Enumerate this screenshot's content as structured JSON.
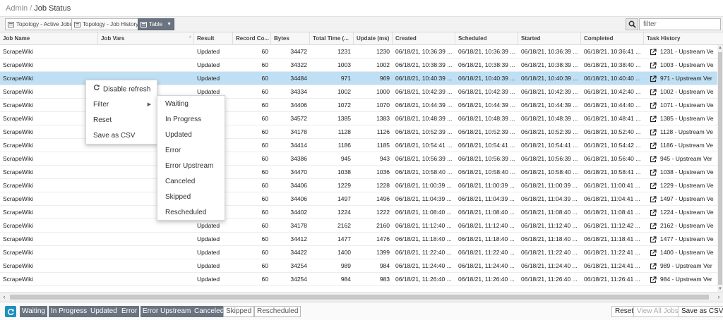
{
  "breadcrumb": {
    "admin": "Admin",
    "separator": "/",
    "current": "Job Status"
  },
  "toolbar": {
    "views": [
      {
        "label": "Topology - Active Jobs",
        "active": false
      },
      {
        "label": "Topology - Job History",
        "active": false
      },
      {
        "label": "Table",
        "active": true
      }
    ],
    "search_placeholder": "filter",
    "search_icon": "search-icon"
  },
  "table": {
    "columns": [
      "Job Name",
      "Job Vars",
      "Result",
      "Record Co...",
      "Bytes",
      "Total Time (...",
      "Update (ms)",
      "Created",
      "Scheduled",
      "Started",
      "Completed",
      "Task History"
    ],
    "sort_indicator": "^",
    "history_icon": "external-link-icon",
    "selected_row": 2,
    "rows": [
      {
        "name": "ScrapeWiki",
        "vars": "",
        "result": "Updated",
        "records": "60",
        "bytes": "34472",
        "total": "1231",
        "update": "1230",
        "created": "06/18/21, 10:36:39 ...",
        "scheduled": "06/18/21, 10:36:39 ...",
        "started": "06/18/21, 10:36:39 ...",
        "completed": "06/18/21, 10:36:41 ...",
        "history": "1231 - Upstream Ve"
      },
      {
        "name": "ScrapeWiki",
        "vars": "",
        "result": "Updated",
        "records": "60",
        "bytes": "34322",
        "total": "1003",
        "update": "1002",
        "created": "06/18/21, 10:38:39 ...",
        "scheduled": "06/18/21, 10:38:39 ...",
        "started": "06/18/21, 10:38:39 ...",
        "completed": "06/18/21, 10:38:40 ...",
        "history": "1003 - Upstream Ve"
      },
      {
        "name": "ScrapeWiki",
        "vars": "",
        "result": "Updated",
        "records": "60",
        "bytes": "34484",
        "total": "971",
        "update": "969",
        "created": "06/18/21, 10:40:39 ...",
        "scheduled": "06/18/21, 10:40:39 ...",
        "started": "06/18/21, 10:40:39 ...",
        "completed": "06/18/21, 10:40:40 ...",
        "history": "971 - Upstream Ver"
      },
      {
        "name": "ScrapeWiki",
        "vars": "",
        "result": "Updated",
        "records": "60",
        "bytes": "34334",
        "total": "1002",
        "update": "1000",
        "created": "06/18/21, 10:42:39 ...",
        "scheduled": "06/18/21, 10:42:39 ...",
        "started": "06/18/21, 10:42:39 ...",
        "completed": "06/18/21, 10:42:40 ...",
        "history": "1002 - Upstream Ve"
      },
      {
        "name": "ScrapeWiki",
        "vars": "",
        "result": "Updated",
        "records": "60",
        "bytes": "34406",
        "total": "1072",
        "update": "1070",
        "created": "06/18/21, 10:44:39 ...",
        "scheduled": "06/18/21, 10:44:39 ...",
        "started": "06/18/21, 10:44:39 ...",
        "completed": "06/18/21, 10:44:40 ...",
        "history": "1071 - Upstream Ve"
      },
      {
        "name": "ScrapeWiki",
        "vars": "",
        "result": "Updated",
        "records": "60",
        "bytes": "34572",
        "total": "1385",
        "update": "1383",
        "created": "06/18/21, 10:48:39 ...",
        "scheduled": "06/18/21, 10:48:39 ...",
        "started": "06/18/21, 10:48:39 ...",
        "completed": "06/18/21, 10:48:41 ...",
        "history": "1385 - Upstream Ve"
      },
      {
        "name": "ScrapeWiki",
        "vars": "",
        "result": "Updated",
        "records": "60",
        "bytes": "34178",
        "total": "1128",
        "update": "1126",
        "created": "06/18/21, 10:52:39 ...",
        "scheduled": "06/18/21, 10:52:39 ...",
        "started": "06/18/21, 10:52:39 ...",
        "completed": "06/18/21, 10:52:40 ...",
        "history": "1128 - Upstream Ve"
      },
      {
        "name": "ScrapeWiki",
        "vars": "",
        "result": "Updated",
        "records": "60",
        "bytes": "34414",
        "total": "1186",
        "update": "1185",
        "created": "06/18/21, 10:54:41 ...",
        "scheduled": "06/18/21, 10:54:41 ...",
        "started": "06/18/21, 10:54:41 ...",
        "completed": "06/18/21, 10:54:42 ...",
        "history": "1186 - Upstream Ve"
      },
      {
        "name": "ScrapeWiki",
        "vars": "",
        "result": "Updated",
        "records": "60",
        "bytes": "34386",
        "total": "945",
        "update": "943",
        "created": "06/18/21, 10:56:39 ...",
        "scheduled": "06/18/21, 10:56:39 ...",
        "started": "06/18/21, 10:56:39 ...",
        "completed": "06/18/21, 10:56:40 ...",
        "history": "945 - Upstream Ver"
      },
      {
        "name": "ScrapeWiki",
        "vars": "",
        "result": "Updated",
        "records": "60",
        "bytes": "34470",
        "total": "1038",
        "update": "1036",
        "created": "06/18/21, 10:58:40 ...",
        "scheduled": "06/18/21, 10:58:40 ...",
        "started": "06/18/21, 10:58:40 ...",
        "completed": "06/18/21, 10:58:41 ...",
        "history": "1038 - Upstream Ve"
      },
      {
        "name": "ScrapeWiki",
        "vars": "",
        "result": "Updated",
        "records": "60",
        "bytes": "34406",
        "total": "1229",
        "update": "1228",
        "created": "06/18/21, 11:00:39 ...",
        "scheduled": "06/18/21, 11:00:39 ...",
        "started": "06/18/21, 11:00:39 ...",
        "completed": "06/18/21, 11:00:41 ...",
        "history": "1229 - Upstream Ve"
      },
      {
        "name": "ScrapeWiki",
        "vars": "",
        "result": "Updated",
        "records": "60",
        "bytes": "34406",
        "total": "1497",
        "update": "1496",
        "created": "06/18/21, 11:04:39 ...",
        "scheduled": "06/18/21, 11:04:39 ...",
        "started": "06/18/21, 11:04:39 ...",
        "completed": "06/18/21, 11:04:41 ...",
        "history": "1497 - Upstream Ve"
      },
      {
        "name": "ScrapeWiki",
        "vars": "",
        "result": "Updated",
        "records": "60",
        "bytes": "34402",
        "total": "1224",
        "update": "1222",
        "created": "06/18/21, 11:08:40 ...",
        "scheduled": "06/18/21, 11:08:40 ...",
        "started": "06/18/21, 11:08:40 ...",
        "completed": "06/18/21, 11:08:41 ...",
        "history": "1224 - Upstream Ve"
      },
      {
        "name": "ScrapeWiki",
        "vars": "",
        "result": "Updated",
        "records": "60",
        "bytes": "34178",
        "total": "2162",
        "update": "2160",
        "created": "06/18/21, 11:12:40 ...",
        "scheduled": "06/18/21, 11:12:40 ...",
        "started": "06/18/21, 11:12:40 ...",
        "completed": "06/18/21, 11:12:42 ...",
        "history": "2162 - Upstream Ve"
      },
      {
        "name": "ScrapeWiki",
        "vars": "",
        "result": "Updated",
        "records": "60",
        "bytes": "34412",
        "total": "1477",
        "update": "1476",
        "created": "06/18/21, 11:18:40 ...",
        "scheduled": "06/18/21, 11:18:40 ...",
        "started": "06/18/21, 11:18:40 ...",
        "completed": "06/18/21, 11:18:41 ...",
        "history": "1477 - Upstream Ve"
      },
      {
        "name": "ScrapeWiki",
        "vars": "",
        "result": "Updated",
        "records": "60",
        "bytes": "34422",
        "total": "1400",
        "update": "1399",
        "created": "06/18/21, 11:22:40 ...",
        "scheduled": "06/18/21, 11:22:40 ...",
        "started": "06/18/21, 11:22:40 ...",
        "completed": "06/18/21, 11:22:41 ...",
        "history": "1400 - Upstream Ve"
      },
      {
        "name": "ScrapeWiki",
        "vars": "",
        "result": "Updated",
        "records": "60",
        "bytes": "34254",
        "total": "989",
        "update": "984",
        "created": "06/18/21, 11:24:40 ...",
        "scheduled": "06/18/21, 11:24:40 ...",
        "started": "06/18/21, 11:24:40 ...",
        "completed": "06/18/21, 11:24:41 ...",
        "history": "989 - Upstream Ver"
      },
      {
        "name": "ScrapeWiki",
        "vars": "",
        "result": "Updated",
        "records": "60",
        "bytes": "34254",
        "total": "984",
        "update": "983",
        "created": "06/18/21, 11:26:40 ...",
        "scheduled": "06/18/21, 11:26:40 ...",
        "started": "06/18/21, 11:26:40 ...",
        "completed": "06/18/21, 11:26:41 ...",
        "history": "984 - Upstream Ver"
      }
    ]
  },
  "context_menu": {
    "items": [
      {
        "label": "Disable refresh",
        "icon": "refresh-icon"
      },
      {
        "label": "Filter",
        "icon": "",
        "submenu": true
      },
      {
        "label": "Reset",
        "icon": ""
      },
      {
        "label": "Save as CSV",
        "icon": ""
      }
    ],
    "filter_submenu": [
      "Waiting",
      "In Progress",
      "Updated",
      "Error",
      "Error Upstream",
      "Canceled",
      "Skipped",
      "Rescheduled"
    ]
  },
  "footer": {
    "refresh_icon": "refresh-icon",
    "statuses": [
      {
        "label": "Waiting",
        "on": true
      },
      {
        "label": "In Progress",
        "on": true
      },
      {
        "label": "Updated",
        "on": true
      },
      {
        "label": "Error",
        "on": true
      },
      {
        "label": "Error Upstream",
        "on": true
      },
      {
        "label": "Canceled",
        "on": true
      },
      {
        "label": "Skipped",
        "on": false
      },
      {
        "label": "Rescheduled",
        "on": false
      }
    ],
    "reset_label": "Reset",
    "view_all_label": "View All Jobs",
    "save_csv_label": "Save as CSV"
  },
  "colors": {
    "selected_row": "#bfe0f4",
    "chip_on": "#6a7480",
    "refresh_button": "#1e8fbf"
  }
}
